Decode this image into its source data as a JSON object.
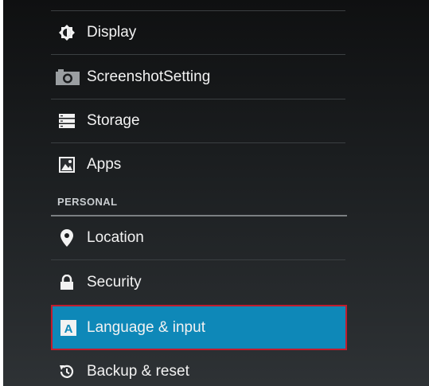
{
  "settings": {
    "items": [
      {
        "label": "Display",
        "icon": "display-brightness-icon"
      },
      {
        "label": "ScreenshotSetting",
        "icon": "camera-icon"
      },
      {
        "label": "Storage",
        "icon": "storage-icon"
      },
      {
        "label": "Apps",
        "icon": "apps-icon"
      },
      {
        "label": "Location",
        "icon": "location-pin-icon"
      },
      {
        "label": "Security",
        "icon": "lock-icon"
      },
      {
        "label": "Language & input",
        "icon": "language-keyboard-icon",
        "selected": true
      },
      {
        "label": "Backup & reset",
        "icon": "backup-restore-icon"
      }
    ],
    "section_personal": "PERSONAL"
  },
  "colors": {
    "selected_background": "#0e88b8",
    "selected_outline": "#c01d2e",
    "background": "#1c1f21"
  }
}
